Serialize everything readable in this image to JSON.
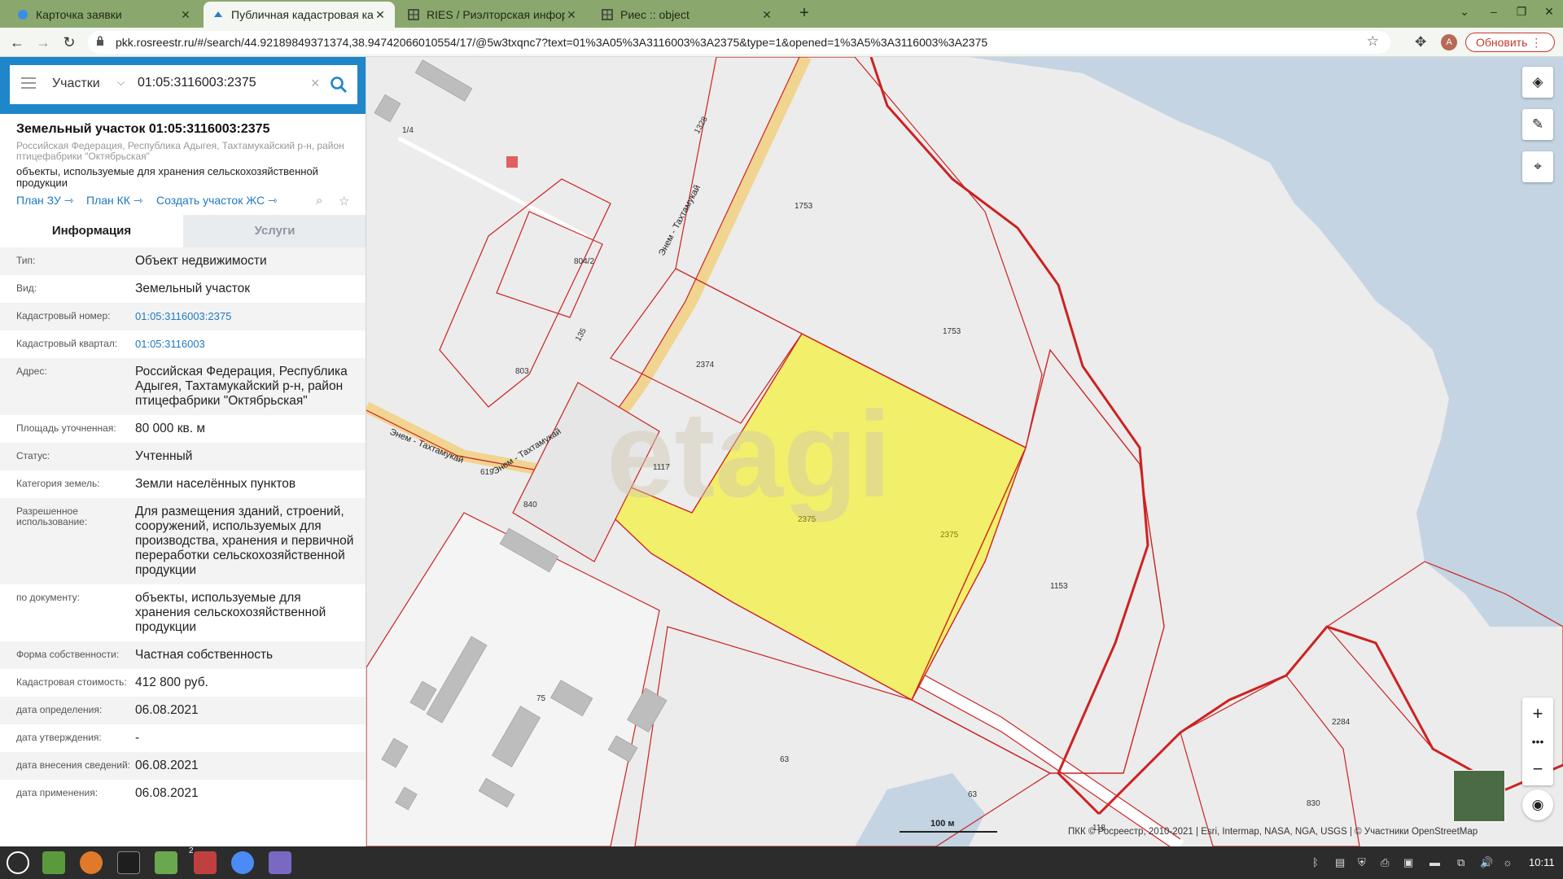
{
  "browser": {
    "tabs": [
      {
        "title": "Карточка заявки",
        "active": false
      },
      {
        "title": "Публичная кадастровая кар",
        "active": true
      },
      {
        "title": "RIES / Риэлторская информ",
        "active": false
      },
      {
        "title": "Риес :: object",
        "active": false
      }
    ],
    "url": "pkk.rosreestr.ru/#/search/44.92189849371374,38.94742066010554/17/@5w3txqnc7?text=01%3A05%3A3116003%3A2375&type=1&opened=1%3A5%3A3116003%3A2375",
    "update_label": "Обновить",
    "avatar_letter": "A"
  },
  "search": {
    "type": "Участки",
    "query": "01:05:3116003:2375"
  },
  "card": {
    "title": "Земельный участок 01:05:3116003:2375",
    "address": "Российская Федерация, Республика Адыгея, Тахтамукайский р-н, район птицефабрики \"Октябрьская\"",
    "use": "объекты, используемые для хранения сельскохозяйственной продукции",
    "links": [
      "План ЗУ",
      "План КК",
      "Создать участок ЖС"
    ]
  },
  "tabs": {
    "info": "Информация",
    "services": "Услуги"
  },
  "properties": [
    {
      "key": "Тип:",
      "value": "Объект недвижимости"
    },
    {
      "key": "Вид:",
      "value": "Земельный участок"
    },
    {
      "key": "Кадастровый номер:",
      "value": "01:05:3116003:2375",
      "link": true
    },
    {
      "key": "Кадастровый квартал:",
      "value": "01:05:3116003",
      "link": true
    },
    {
      "key": "Адрес:",
      "value": "Российская Федерация, Республика Адыгея, Тахтамукайский р-н, район птицефабрики \"Октябрьская\""
    },
    {
      "key": "Площадь уточненная:",
      "value": "80 000 кв. м"
    },
    {
      "key": "Статус:",
      "value": "Учтенный"
    },
    {
      "key": "Категория земель:",
      "value": "Земли населённых пунктов"
    },
    {
      "key": "Разрешенное использование:",
      "value": "Для размещения зданий, строений, сооружений, используемых для производства, хранения и первичной переработки сельскохозяйственной продукции"
    },
    {
      "key": "по документу:",
      "value": "объекты, используемые для хранения сельскохозяйственной продукции"
    },
    {
      "key": "Форма собственности:",
      "value": "Частная собственность"
    },
    {
      "key": "Кадастровая стоимость:",
      "value": "412 800 руб."
    },
    {
      "key": "дата определения:",
      "value": "06.08.2021"
    },
    {
      "key": "дата утверждения:",
      "value": "-"
    },
    {
      "key": "дата внесения сведений:",
      "value": "06.08.2021"
    },
    {
      "key": "дата применения:",
      "value": "06.08.2021"
    }
  ],
  "map": {
    "parcel_labels": [
      "1/4",
      "1328",
      "1753",
      "804/2",
      "1753",
      "135",
      "803",
      "2374",
      "1117",
      "619",
      "840",
      "2375",
      "2375",
      "1153",
      "75",
      "63",
      "63",
      "2284",
      "830",
      "118"
    ],
    "road_labels": [
      "Энем - Тахтамукай",
      "Энем - Тахтамукай",
      "Энем - Тахтамукай"
    ],
    "watermark": "etagi",
    "scale": "100 м",
    "attribution": "ПКК © Росреестр, 2010-2021 | Esri, Intermap, NASA, NGA, USGS | © Участники OpenStreetMap",
    "colors": {
      "selected_parcel": "#f2ef6a",
      "boundary": "#cc2222",
      "water": "#c4d4e2",
      "road": "#f2d98a"
    }
  },
  "taskbar": {
    "clock": "10:11",
    "badge": "2"
  }
}
